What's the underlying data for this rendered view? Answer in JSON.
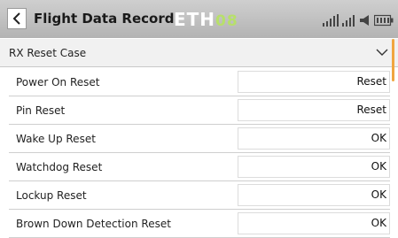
{
  "header": {
    "title": "Flight Data Record",
    "logo_text": "ETH",
    "logo_number": "08",
    "back_icon": "chevron-left-icon",
    "status_icons": [
      "signal-icon",
      "signal-icon",
      "speaker-icon",
      "battery-icon"
    ]
  },
  "section": {
    "label": "RX Reset Case",
    "expand_icon": "chevron-down-icon"
  },
  "rows": [
    {
      "label": "Power On Reset",
      "value": "Reset"
    },
    {
      "label": "Pin Reset",
      "value": "Reset"
    },
    {
      "label": "Wake Up Reset",
      "value": "OK"
    },
    {
      "label": "Watchdog Reset",
      "value": "OK"
    },
    {
      "label": "Lockup Reset",
      "value": "OK"
    },
    {
      "label": "Brown Down Detection Reset",
      "value": "OK"
    }
  ],
  "colors": {
    "header_bg": "#c0c0c0",
    "logo_accent": "#b7e06a",
    "scrollbar": "#f0a640"
  }
}
